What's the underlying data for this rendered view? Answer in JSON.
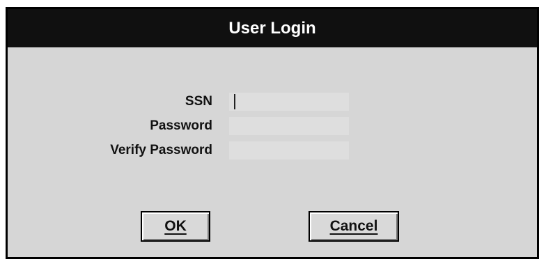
{
  "dialog": {
    "title": "User Login",
    "fields": {
      "ssn": {
        "label": "SSN",
        "value": ""
      },
      "password": {
        "label": "Password",
        "value": ""
      },
      "verify_password": {
        "label": "Verify Password",
        "value": ""
      }
    },
    "buttons": {
      "ok_label": "OK",
      "cancel_label": "Cancel"
    }
  },
  "colors": {
    "dialog_background": "#d6d6d6",
    "titlebar_background": "#101010",
    "titlebar_text": "#ffffff",
    "border": "#000000"
  }
}
